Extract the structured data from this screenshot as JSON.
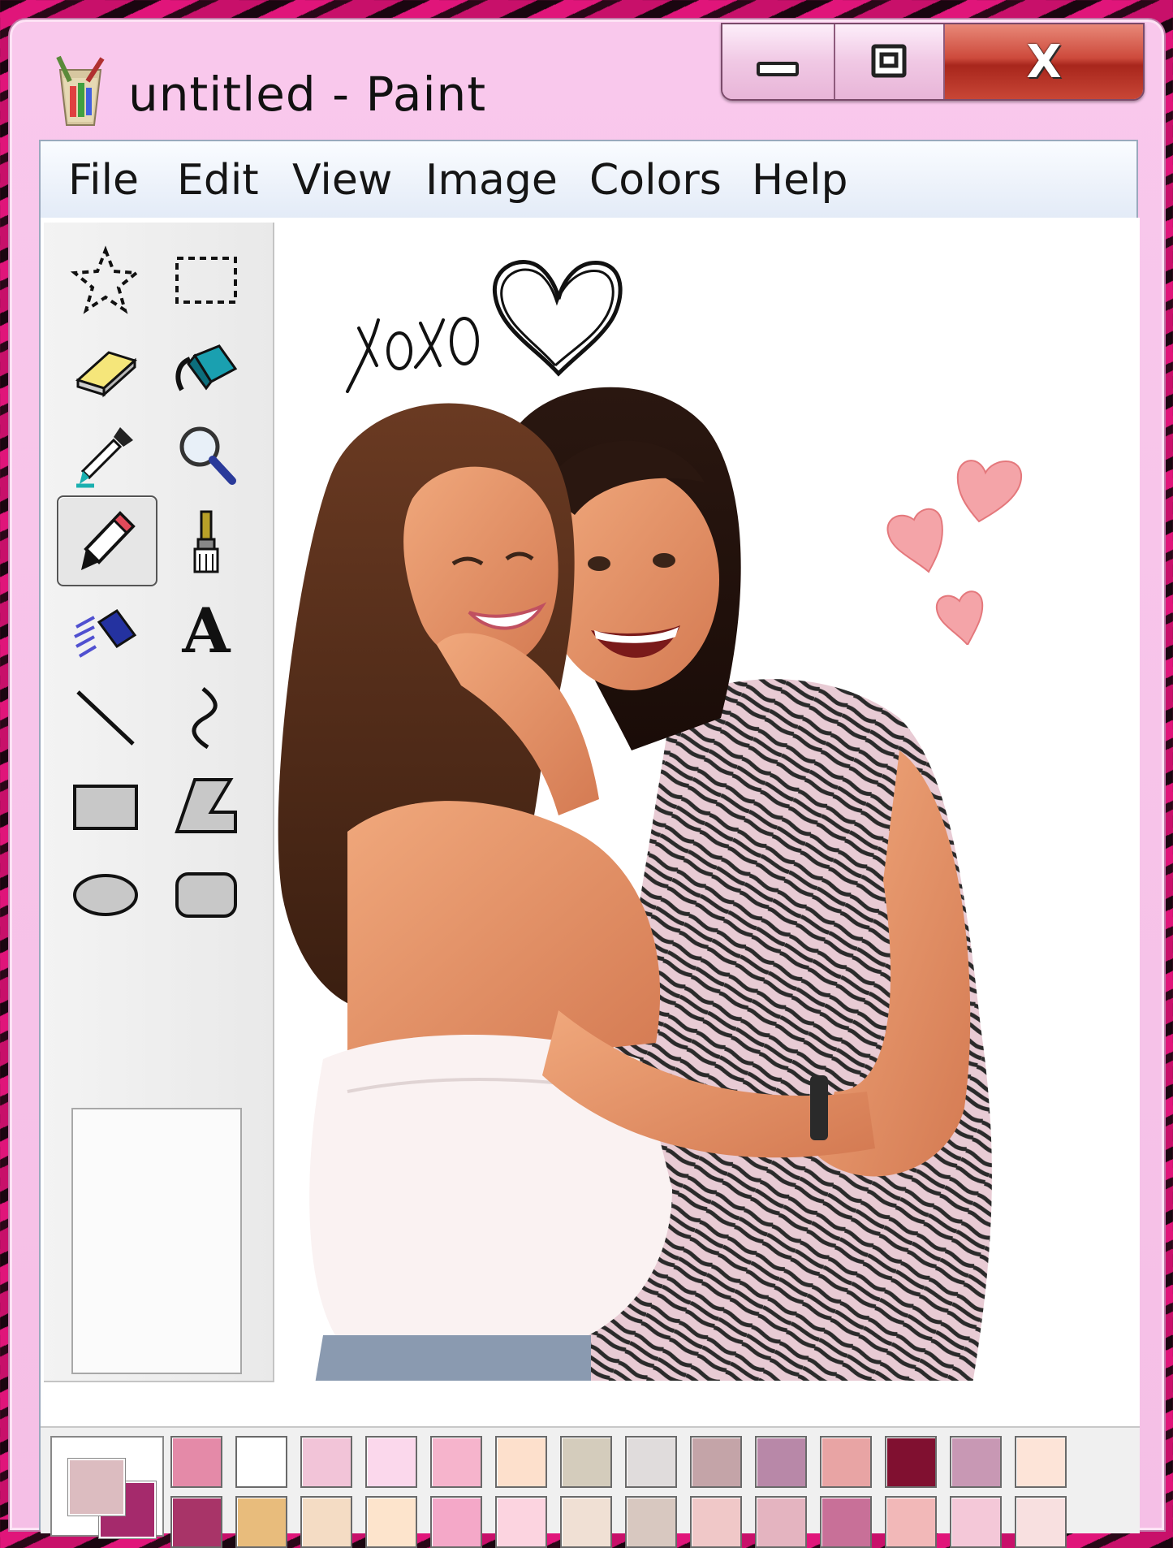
{
  "window": {
    "title": "untitled - Paint",
    "icon": "paint-bucket-icon",
    "buttons": [
      "minimize-icon",
      "maximize-icon",
      "close-icon"
    ],
    "close_label": "X"
  },
  "menu": {
    "items": [
      "File",
      "Edit",
      "View",
      "Image",
      "Colors",
      "Help"
    ]
  },
  "tools": [
    {
      "name": "free-form-select",
      "icon": "star-select-icon"
    },
    {
      "name": "select",
      "icon": "rect-select-icon"
    },
    {
      "name": "eraser",
      "icon": "eraser-icon"
    },
    {
      "name": "fill-with-color",
      "icon": "fill-bucket-icon"
    },
    {
      "name": "pick-color",
      "icon": "eyedropper-icon"
    },
    {
      "name": "magnifier",
      "icon": "magnifier-icon"
    },
    {
      "name": "pencil",
      "icon": "pencil-icon",
      "active": true
    },
    {
      "name": "brush",
      "icon": "brush-icon"
    },
    {
      "name": "airbrush",
      "icon": "airbrush-icon"
    },
    {
      "name": "text",
      "icon": "text-icon",
      "label": "A"
    },
    {
      "name": "line",
      "icon": "line-icon"
    },
    {
      "name": "curve",
      "icon": "curve-icon"
    },
    {
      "name": "rectangle",
      "icon": "rectangle-icon"
    },
    {
      "name": "polygon",
      "icon": "polygon-icon"
    },
    {
      "name": "ellipse",
      "icon": "ellipse-icon"
    },
    {
      "name": "rounded-rectangle",
      "icon": "rounded-rect-icon"
    }
  ],
  "canvas": {
    "handwriting": "xoxo",
    "photo": "two-friends-hugging-photo"
  },
  "palette": {
    "foreground": "#dcbcc0",
    "background": "#a52a6c",
    "row1": [
      "#e48aa8",
      "#ffffff",
      "#f2c4d8",
      "#fbd8ec",
      "#f6b4cc",
      "#fde0cc",
      "#d4ccbc",
      "#e0dcdc",
      "#c4a4a8",
      "#b888a8",
      "#e8a4a4",
      "#801030",
      "#c898b4",
      "#fde4d8"
    ],
    "row2": [
      "#a83468",
      "#e8bc7c",
      "#f4dcc4",
      "#fde4cc",
      "#f4a8c8",
      "#fcd4e0",
      "#f0e0d4",
      "#d8c8c0",
      "#f0c8c8",
      "#e4b4c0",
      "#c87098",
      "#f2b8b8",
      "#f4c8d8",
      "#f8e0e0"
    ]
  }
}
